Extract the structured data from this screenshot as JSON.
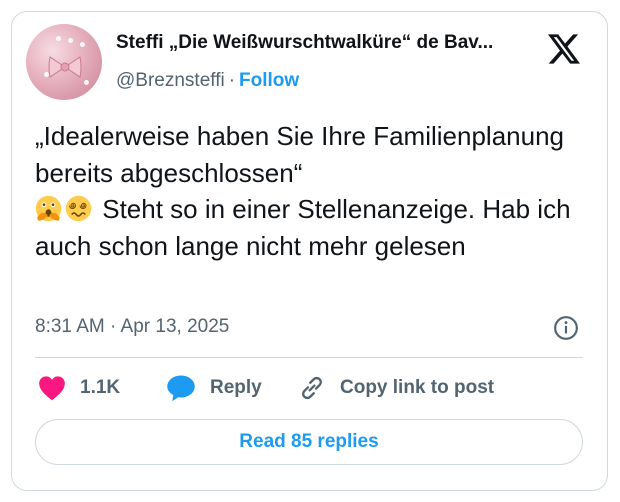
{
  "author": {
    "display_name": "Steffi „Die Weißwurschtwalküre“ de Bav...",
    "handle": "@Breznsteffi",
    "separator": "·",
    "follow_label": "Follow"
  },
  "tweet": {
    "text": "„Idealerweise haben Sie Ihre Familienplanung bereits abgeschlossen“",
    "text_after_emoji": "Steht so in einer Stellenanzeige. Hab ich auch schon lange nicht mehr gelesen",
    "emojis": [
      "face-hand-over-mouth-emoji",
      "face-spiral-eyes-emoji"
    ],
    "timestamp": "8:31 AM · Apr 13, 2025"
  },
  "actions": {
    "like_count": "1.1K",
    "reply_label": "Reply",
    "copy_label": "Copy link to post"
  },
  "read_replies_label": "Read 85 replies",
  "colors": {
    "accent": "#1d9bf0",
    "like": "#f91880",
    "reply_icon": "#1d9bf0",
    "muted": "#536471",
    "border": "#cfd9de"
  }
}
